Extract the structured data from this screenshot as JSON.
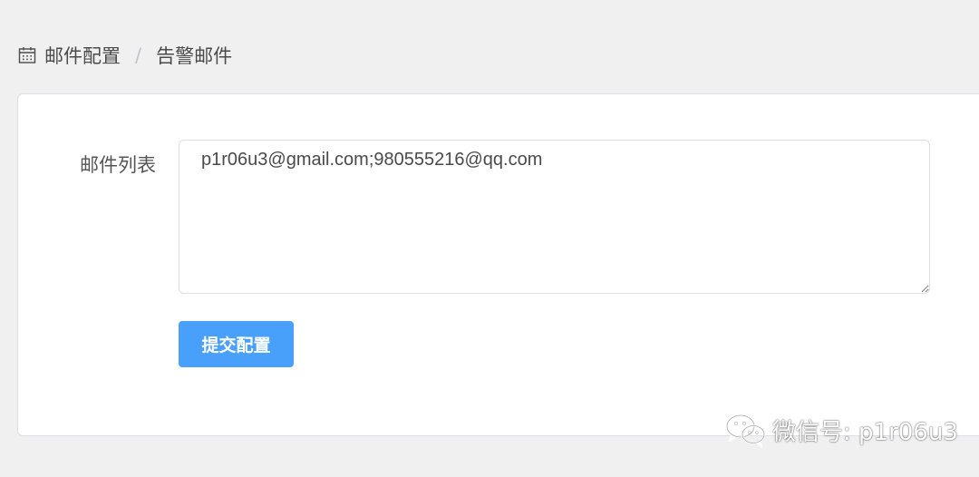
{
  "breadcrumb": {
    "items": [
      "邮件配置",
      "告警邮件"
    ],
    "separator": "/"
  },
  "form": {
    "label": "邮件列表",
    "email_list_value": "p1r06u3@gmail.com;980555216@qq.com"
  },
  "actions": {
    "submit_label": "提交配置"
  },
  "watermark": {
    "text": "微信号: p1r06u3"
  },
  "colors": {
    "primary": "#48a0fa",
    "background": "#f0f0f0",
    "card": "#ffffff"
  }
}
